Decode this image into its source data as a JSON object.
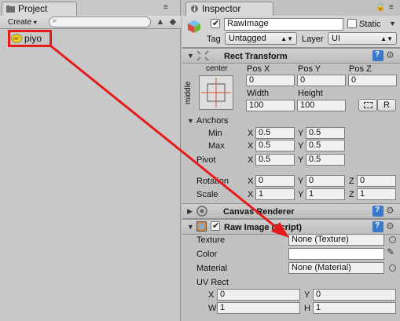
{
  "project_panel": {
    "tab_label": "Project",
    "create_label": "Create",
    "create_arrow": "▾",
    "search_placeholder": "",
    "items": [
      {
        "label": "piyo"
      }
    ]
  },
  "inspector": {
    "tab_label": "Inspector",
    "object": {
      "name": "RawImage",
      "static_label": "Static",
      "tag_label": "Tag",
      "tag_value": "Untagged",
      "layer_label": "Layer",
      "layer_value": "UI"
    },
    "rect_transform": {
      "title": "Rect Transform",
      "anchor_preset_top": "center",
      "anchor_preset_side": "middle",
      "pos_x_label": "Pos X",
      "pos_x": "0",
      "pos_y_label": "Pos Y",
      "pos_y": "0",
      "pos_z_label": "Pos Z",
      "pos_z": "0",
      "width_label": "Width",
      "width": "100",
      "height_label": "Height",
      "height": "100",
      "raw_button": "R",
      "anchors_label": "Anchors",
      "min_label": "Min",
      "min_x": "0.5",
      "min_y": "0.5",
      "max_label": "Max",
      "max_x": "0.5",
      "max_y": "0.5",
      "pivot_label": "Pivot",
      "pivot_x": "0.5",
      "pivot_y": "0.5",
      "rotation_label": "Rotation",
      "rot_x": "0",
      "rot_y": "0",
      "rot_z": "0",
      "scale_label": "Scale",
      "scale_x": "1",
      "scale_y": "1",
      "scale_z": "1",
      "axis_x": "X",
      "axis_y": "Y",
      "axis_z": "Z"
    },
    "canvas_renderer": {
      "title": "Canvas Renderer"
    },
    "raw_image": {
      "title": "Raw Image (Script)",
      "texture_label": "Texture",
      "texture_value": "None (Texture)",
      "color_label": "Color",
      "color_value": "#ffffff",
      "material_label": "Material",
      "material_value": "None (Material)",
      "uv_rect_label": "UV Rect",
      "uv_x": "0",
      "uv_y": "0",
      "uv_w": "1",
      "uv_h": "1",
      "label_w": "W",
      "label_h": "H"
    }
  },
  "annotation": {
    "color": "#e51b1b"
  }
}
